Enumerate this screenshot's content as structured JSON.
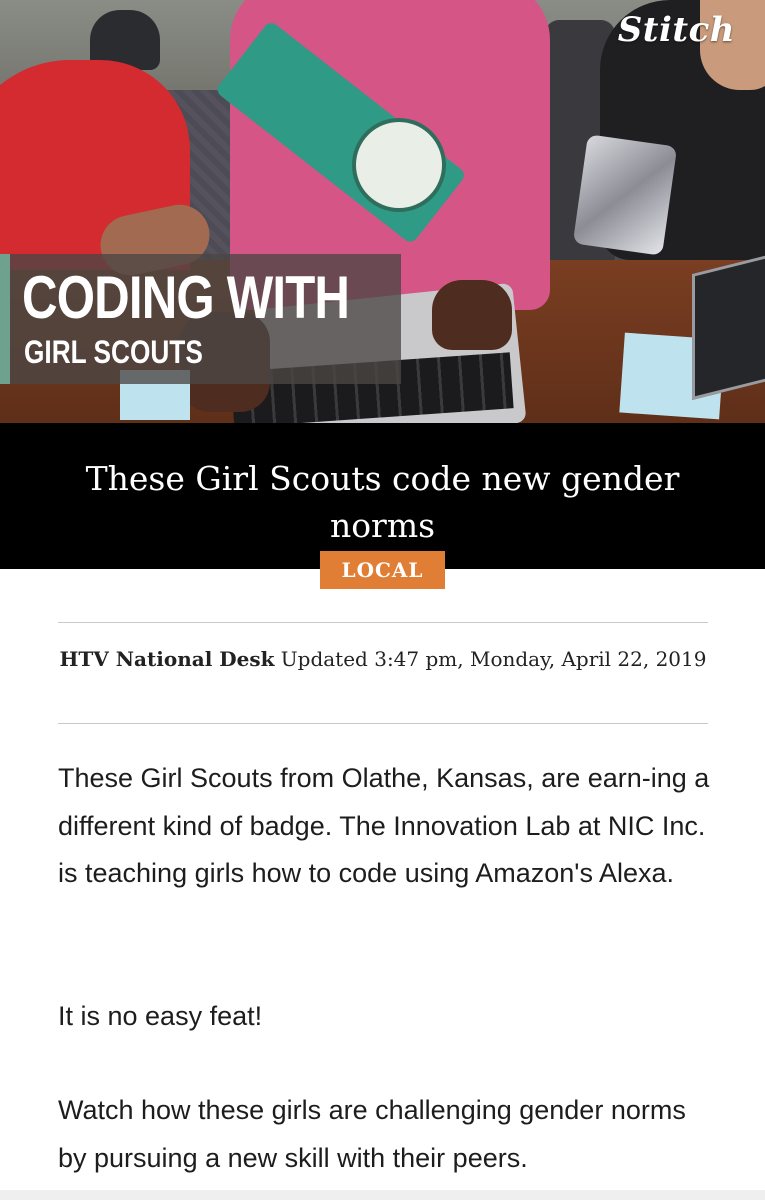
{
  "brand": {
    "logo_text": "Stitch"
  },
  "hero": {
    "title_line1": "CODING WITH",
    "title_line2": "GIRL SCOUTS"
  },
  "article": {
    "headline": "These Girl Scouts code new gender norms",
    "category": "LOCAL",
    "author": "HTV National Desk",
    "updated": "Updated 3:47 pm, Monday, April 22, 2019",
    "paragraphs": [
      "These Girl Scouts from Olathe, Kansas, are earn-ing a different kind of badge. The Innovation Lab at NIC Inc. is teaching girls how to code using Amazon's Alexa.",
      "It is no easy feat!",
      "Watch how these girls are challenging gender norms by pursuing a new skill with their peers."
    ]
  },
  "colors": {
    "accent_badge": "#e07e35",
    "overlay_bar": "#6fa28e",
    "headline_band": "#000000"
  }
}
